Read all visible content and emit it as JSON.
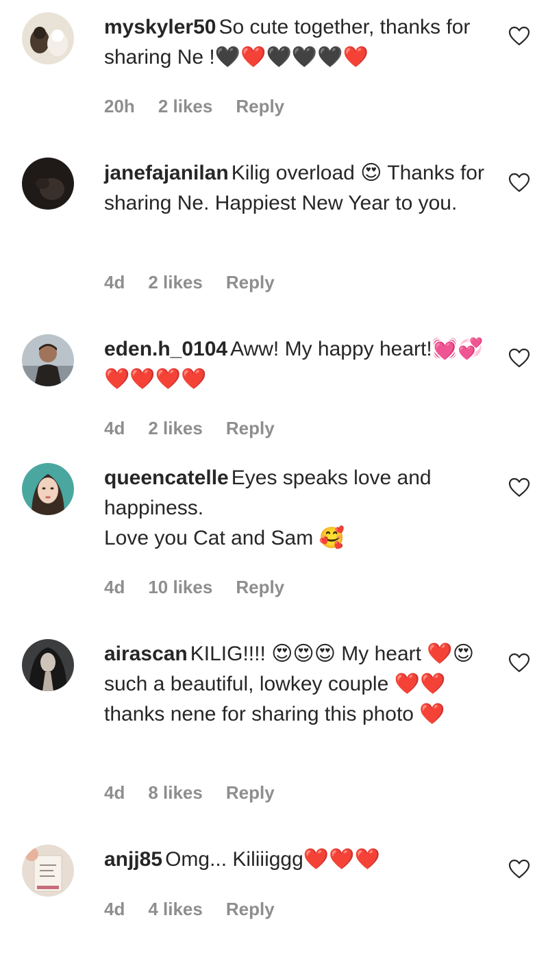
{
  "comments": [
    {
      "username": "myskyler50",
      "text": "So cute together, thanks for sharing Ne !🖤❤️🖤🖤🖤❤️",
      "time": "20h",
      "likes": "2 likes",
      "reply": "Reply"
    },
    {
      "username": "janefajanilan",
      "text": "Kilig overload 😍 Thanks for sharing Ne. Happiest New Year to you.",
      "time": "4d",
      "likes": "2 likes",
      "reply": "Reply"
    },
    {
      "username": "eden.h_0104",
      "text": "Aww! My happy heart!💓💞❤️❤️❤️❤️",
      "time": "4d",
      "likes": "2 likes",
      "reply": "Reply"
    },
    {
      "username": "queencatelle",
      "text": "Eyes speaks love and happiness.\nLove you Cat and Sam 🥰",
      "time": "4d",
      "likes": "10 likes",
      "reply": "Reply"
    },
    {
      "username": "airascan",
      "text": "KILIG!!!! 😍😍😍 My heart ❤️😍 such a beautiful, lowkey couple ❤️❤️ thanks nene for sharing this photo ❤️",
      "time": "4d",
      "likes": "8 likes",
      "reply": "Reply"
    },
    {
      "username": "anjj85",
      "text": "Omg... Kiliiiggg❤️❤️❤️",
      "time": "4d",
      "likes": "4 likes",
      "reply": "Reply"
    }
  ]
}
